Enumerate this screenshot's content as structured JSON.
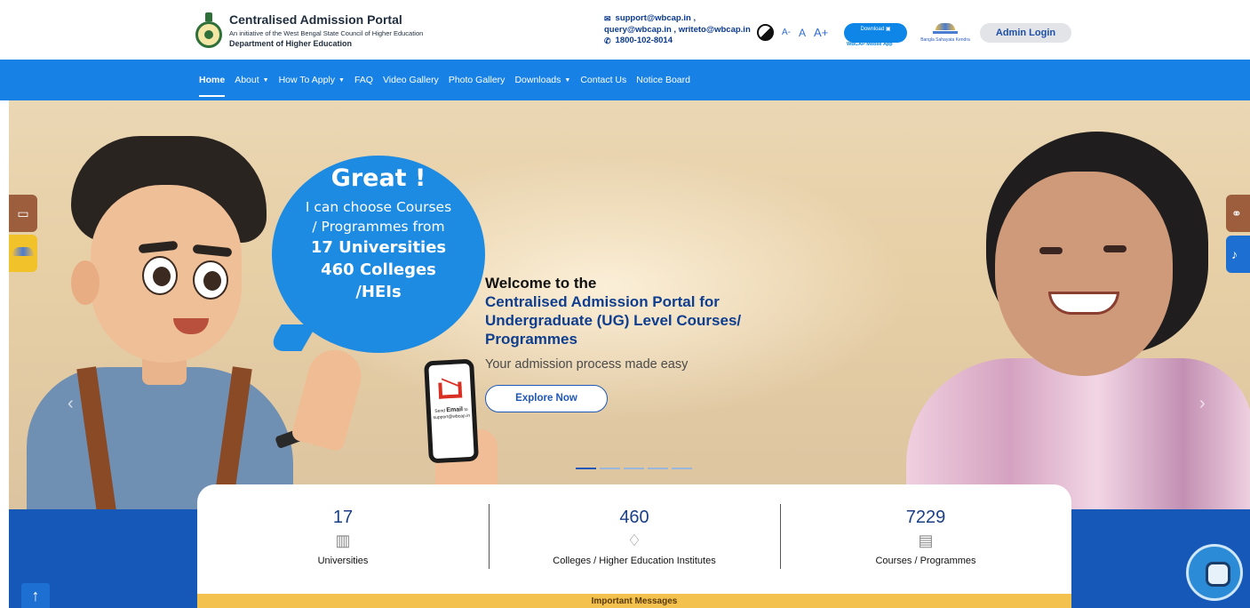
{
  "header": {
    "title": "Centralised Admission Portal",
    "subtitle": "An initiative of the West Bengal State Council of Higher Education",
    "department": "Department of Higher Education",
    "contact": {
      "email_1": "support@wbcap.in ,",
      "email_2": "query@wbcap.in , writeto@wbcap.in",
      "phone": "1800-102-8014"
    },
    "font_small": "A-",
    "font_normal": "A",
    "font_large": "A+",
    "download_label": "Download",
    "download_sub": "WBCAP Mobile App",
    "bsk_label": "Bangla Sahayata Kendra",
    "admin_login": "Admin Login"
  },
  "nav": {
    "items": [
      "Home",
      "About",
      "How To Apply",
      "FAQ",
      "Video Gallery",
      "Photo Gallery",
      "Downloads",
      "Contact Us",
      "Notice Board"
    ]
  },
  "hero": {
    "bubble_great": "Great !",
    "bubble_line1": "I can choose Courses",
    "bubble_line2": "/ Programmes from",
    "bubble_line3": "17 Universities",
    "bubble_line4": "460 Colleges",
    "bubble_line5": "/HEIs",
    "phone_text_1": "Send",
    "phone_text_2": "Email",
    "phone_text_3": "to",
    "phone_text_4": "support@wbcap.in",
    "welcome_line": "Welcome to the",
    "welcome_title": "Centralised Admission Portal for Undergraduate (UG) Level Courses/ Programmes",
    "tagline": "Your admission process made easy",
    "cta": "Explore Now",
    "slide_count": 5,
    "active_slide": 1
  },
  "stats": [
    {
      "value": "17",
      "label": "Universities",
      "icon": "building-icon"
    },
    {
      "value": "460",
      "label": "Colleges / Higher Education Institutes",
      "icon": "graduation-cap-icon"
    },
    {
      "value": "7229",
      "label": "Courses / Programmes",
      "icon": "book-icon"
    }
  ],
  "important_messages": "Important Messages",
  "colors": {
    "nav": "#1781e6",
    "band": "#1558b8",
    "accent_yellow": "#f2c14e"
  }
}
